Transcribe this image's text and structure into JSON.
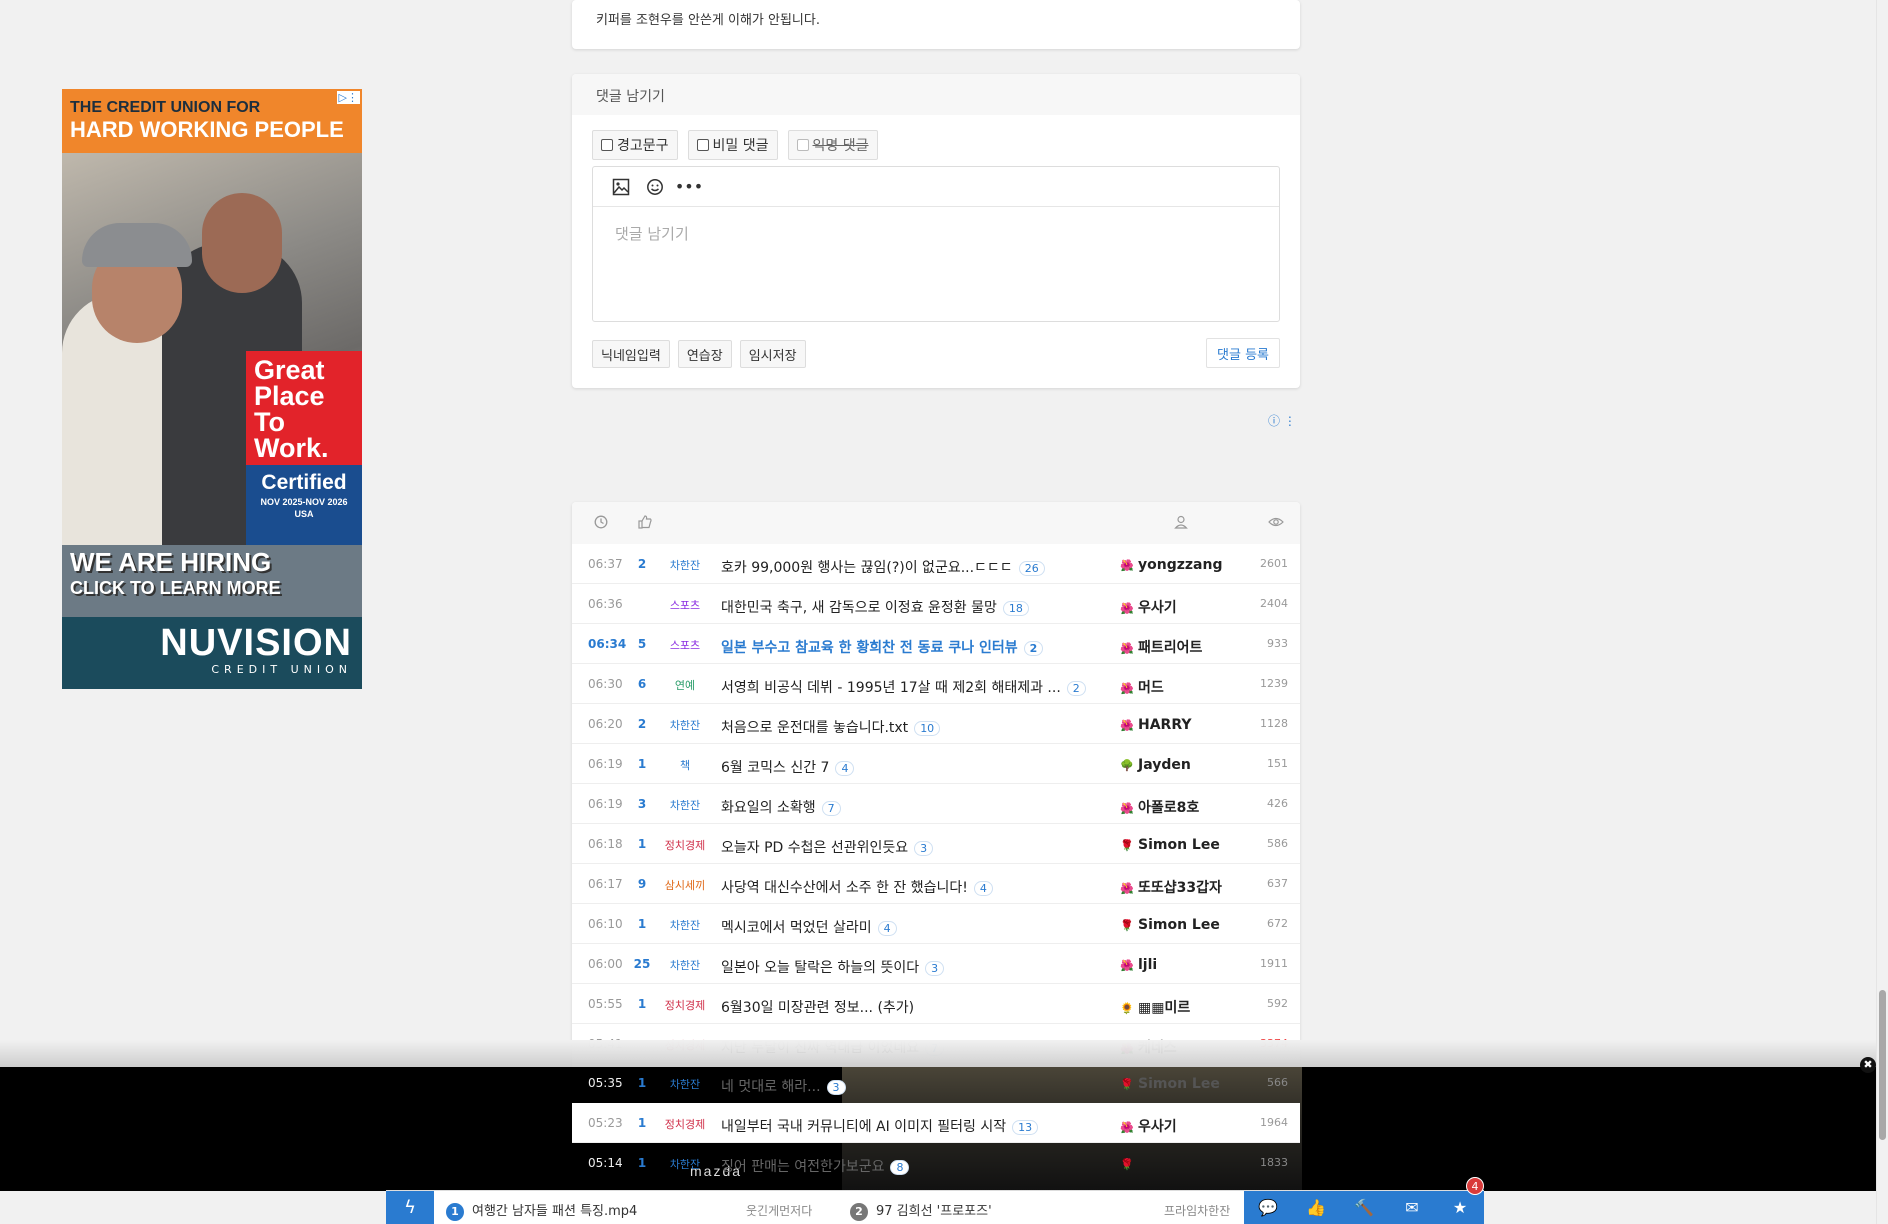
{
  "prev_comment": "키퍼를 조현우를 안쓴게 이해가 안됩니다.",
  "comment_form": {
    "title": "댓글 남기기",
    "options": [
      "경고문구",
      "비밀 댓글",
      "익명 댓글"
    ],
    "placeholder": "댓글 남기기",
    "buttons": [
      "닉네임입력",
      "연습장",
      "임시저장"
    ],
    "submit": "댓글 등록"
  },
  "ad_left": {
    "line1": "THE CREDIT UNION FOR",
    "line2": "HARD WORKING PEOPLE",
    "badge": [
      "Great",
      "Place",
      "To",
      "Work."
    ],
    "certified": "Certified",
    "cert_date": "NOV 2025-NOV 2026",
    "cert_country": "USA",
    "hiring": "WE ARE HIRING",
    "cta": "CLICK TO LEARN MORE",
    "brand": "NUVISION",
    "brand_sub": "CREDIT UNION"
  },
  "posts": [
    {
      "time": "06:37",
      "rec": "2",
      "cat": "차한잔",
      "cat_color": "#2a7bd0",
      "title": "호카 99,000원 행사는 끊임(?)이 없군요...ㄷㄷㄷ",
      "comments": "26",
      "lvl": "🌺",
      "author": "yongzzang",
      "views": "2601"
    },
    {
      "time": "06:36",
      "rec": "",
      "cat": "스포츠",
      "cat_color": "#8a2be2",
      "title": "대한민국 축구, 새 감독으로 이정효 윤정환 물망",
      "comments": "18",
      "lvl": "🌺",
      "author": "우사기",
      "views": "2404"
    },
    {
      "time": "06:34",
      "rec": "5",
      "cat": "스포츠",
      "cat_color": "#8a2be2",
      "title": "일본 부수고 참교육 한 황희찬 전 동료 쿠나 인터뷰",
      "comments": "2",
      "lvl": "🌺",
      "author": "패트리어트",
      "views": "933",
      "highlight": true
    },
    {
      "time": "06:30",
      "rec": "6",
      "cat": "연예",
      "cat_color": "#2a9d6a",
      "title": "서영희 비공식 데뷔 - 1995년 17살 때 제2회 해태제과 ...",
      "comments": "2",
      "lvl": "🌺",
      "author": "머드",
      "views": "1239"
    },
    {
      "time": "06:20",
      "rec": "2",
      "cat": "차한잔",
      "cat_color": "#2a7bd0",
      "title": "처음으로 운전대를 놓습니다.txt",
      "comments": "10",
      "lvl": "🌺",
      "author": "HARRY",
      "views": "1128"
    },
    {
      "time": "06:19",
      "rec": "1",
      "cat": "책",
      "cat_color": "#2a7bd0",
      "title": "6월 코믹스 신간 7",
      "comments": "4",
      "lvl": "🌳",
      "author": "Jayden",
      "views": "151"
    },
    {
      "time": "06:19",
      "rec": "3",
      "cat": "차한잔",
      "cat_color": "#2a7bd0",
      "title": "화요일의 소확행",
      "comments": "7",
      "lvl": "🌺",
      "author": "아폴로8호",
      "views": "426"
    },
    {
      "time": "06:18",
      "rec": "1",
      "cat": "정치경제",
      "cat_color": "#d0304a",
      "title": "오늘자 PD 수첩은 선관위인듯요",
      "comments": "3",
      "lvl": "🌹",
      "author": "Simon Lee",
      "views": "586"
    },
    {
      "time": "06:17",
      "rec": "9",
      "cat": "삼시세끼",
      "cat_color": "#e06a1a",
      "title": "사당역 대신수산에서 소주 한 잔 했습니다!",
      "comments": "4",
      "lvl": "🌺",
      "author": "또또샵33갑자",
      "views": "637"
    },
    {
      "time": "06:10",
      "rec": "1",
      "cat": "차한잔",
      "cat_color": "#2a7bd0",
      "title": "멕시코에서 먹었던 살라미",
      "comments": "4",
      "lvl": "🌹",
      "author": "Simon Lee",
      "views": "672"
    },
    {
      "time": "06:00",
      "rec": "25",
      "cat": "차한잔",
      "cat_color": "#2a7bd0",
      "title": "일본아 오늘 탈락은 하늘의 뜻이다",
      "comments": "3",
      "lvl": "🌺",
      "author": "ljli",
      "views": "1911"
    },
    {
      "time": "05:55",
      "rec": "1",
      "cat": "정치경제",
      "cat_color": "#d0304a",
      "title": "6월30일 미장관련 정보... (추가)",
      "comments": "",
      "lvl": "🌻",
      "author": "▦▦미르",
      "views": "592"
    },
    {
      "time": "05:41",
      "rec": "",
      "cat": "정치경제",
      "cat_color": "#d0304a",
      "title": "지난 두달이 진짜 역대급 이었네요",
      "comments": "7",
      "lvl": "🌺",
      "author": "케네스",
      "views": "3374",
      "views_hot": true
    }
  ],
  "overlay_rows": [
    {
      "time": "05:35",
      "rec": "1",
      "cat": "차한잔",
      "title": "네 멋대로 해라...",
      "comments": "3",
      "author": "Simon Lee",
      "views": "566"
    },
    {
      "time": "05:23",
      "rec": "1",
      "cat": "정치경제",
      "title": "내일부터 국내 커뮤니티에 AI 이미지 필터링 시작",
      "comments": "13",
      "lvl": "🌺",
      "author": "우사기",
      "views": "1964"
    },
    {
      "time": "05:14",
      "rec": "1",
      "cat": "차한잔",
      "title": "징어 판매는 여전한가보군요",
      "comments": "8",
      "author": "",
      "views": "1833"
    }
  ],
  "overlay_ad": {
    "brand": "mazda"
  },
  "list_header_icons": [
    "clock-icon",
    "thumbs-up-icon",
    "user-icon",
    "eye-icon"
  ],
  "bottom_bar": {
    "items": [
      {
        "num": "1",
        "num_color": "#2a7bd0",
        "text": "여행간 남자들 패션 특징.mp4",
        "cat": "웃긴게먼저다"
      },
      {
        "num": "2",
        "num_color": "#777",
        "text": "97 김희선 '프로포즈'",
        "cat": "프라임차한잔"
      }
    ],
    "badge": "4"
  },
  "colors": {
    "accent": "#2a7bd0",
    "hot": "#e44444"
  }
}
